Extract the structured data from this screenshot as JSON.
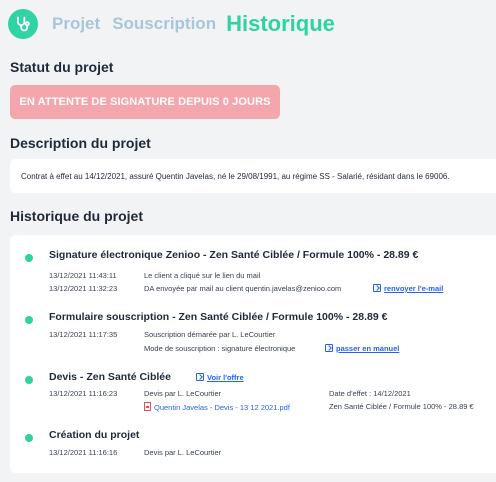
{
  "nav": {
    "tabs": [
      "Projet",
      "Souscription",
      "Historique"
    ],
    "active": "Historique"
  },
  "status": {
    "title": "Statut du projet",
    "badge": "EN ATTENTE DE SIGNATURE DEPUIS 0 JOURS"
  },
  "description": {
    "title": "Description du projet",
    "text": "Contrat à effet au 14/12/2021, assuré Quentin Javelas, né le 29/08/1991, au régime SS - Salarié, résidant dans le 69006."
  },
  "history": {
    "title": "Historique du projet",
    "entries": [
      {
        "title": "Signature électronique Zenioo - Zen Santé Ciblée / Formule 100% - 28.89 €",
        "rows": [
          {
            "date": "13/12/2021 11:43:11",
            "text": "Le client a cliqué sur le lien du mail"
          },
          {
            "date": "13/12/2021 11:32:23",
            "text": "DA envoyée par mail au client quentin.javelas@zenioo.com",
            "link": "renvoyer l'e-mail"
          }
        ]
      },
      {
        "title": "Formulaire souscription - Zen Santé Ciblée / Formule 100% - 28.89 €",
        "rows": [
          {
            "date": "13/12/2021 11:17:35",
            "text": "Souscription démarée par L. LeCourtier"
          },
          {
            "text": "Mode de souscription : signature électronique",
            "link": "passer en manuel"
          }
        ]
      },
      {
        "title": "Devis - Zen Santé Ciblée",
        "title_link": "Voir l'offre",
        "rows": [
          {
            "date": "13/12/2021 11:16:23",
            "text": "Devis par L. LeCourtier",
            "right": "Date d'effet : 14/12/2021"
          },
          {
            "file": "Quentin Javelas - Devis - 13 12 2021.pdf",
            "right": "Zen Santé Ciblée / Formule 100% - 28.89 €"
          }
        ]
      },
      {
        "title": "Création du projet",
        "rows": [
          {
            "date": "13/12/2021 11:16:16",
            "text": "Devis par L. LeCourtier"
          }
        ]
      }
    ]
  }
}
